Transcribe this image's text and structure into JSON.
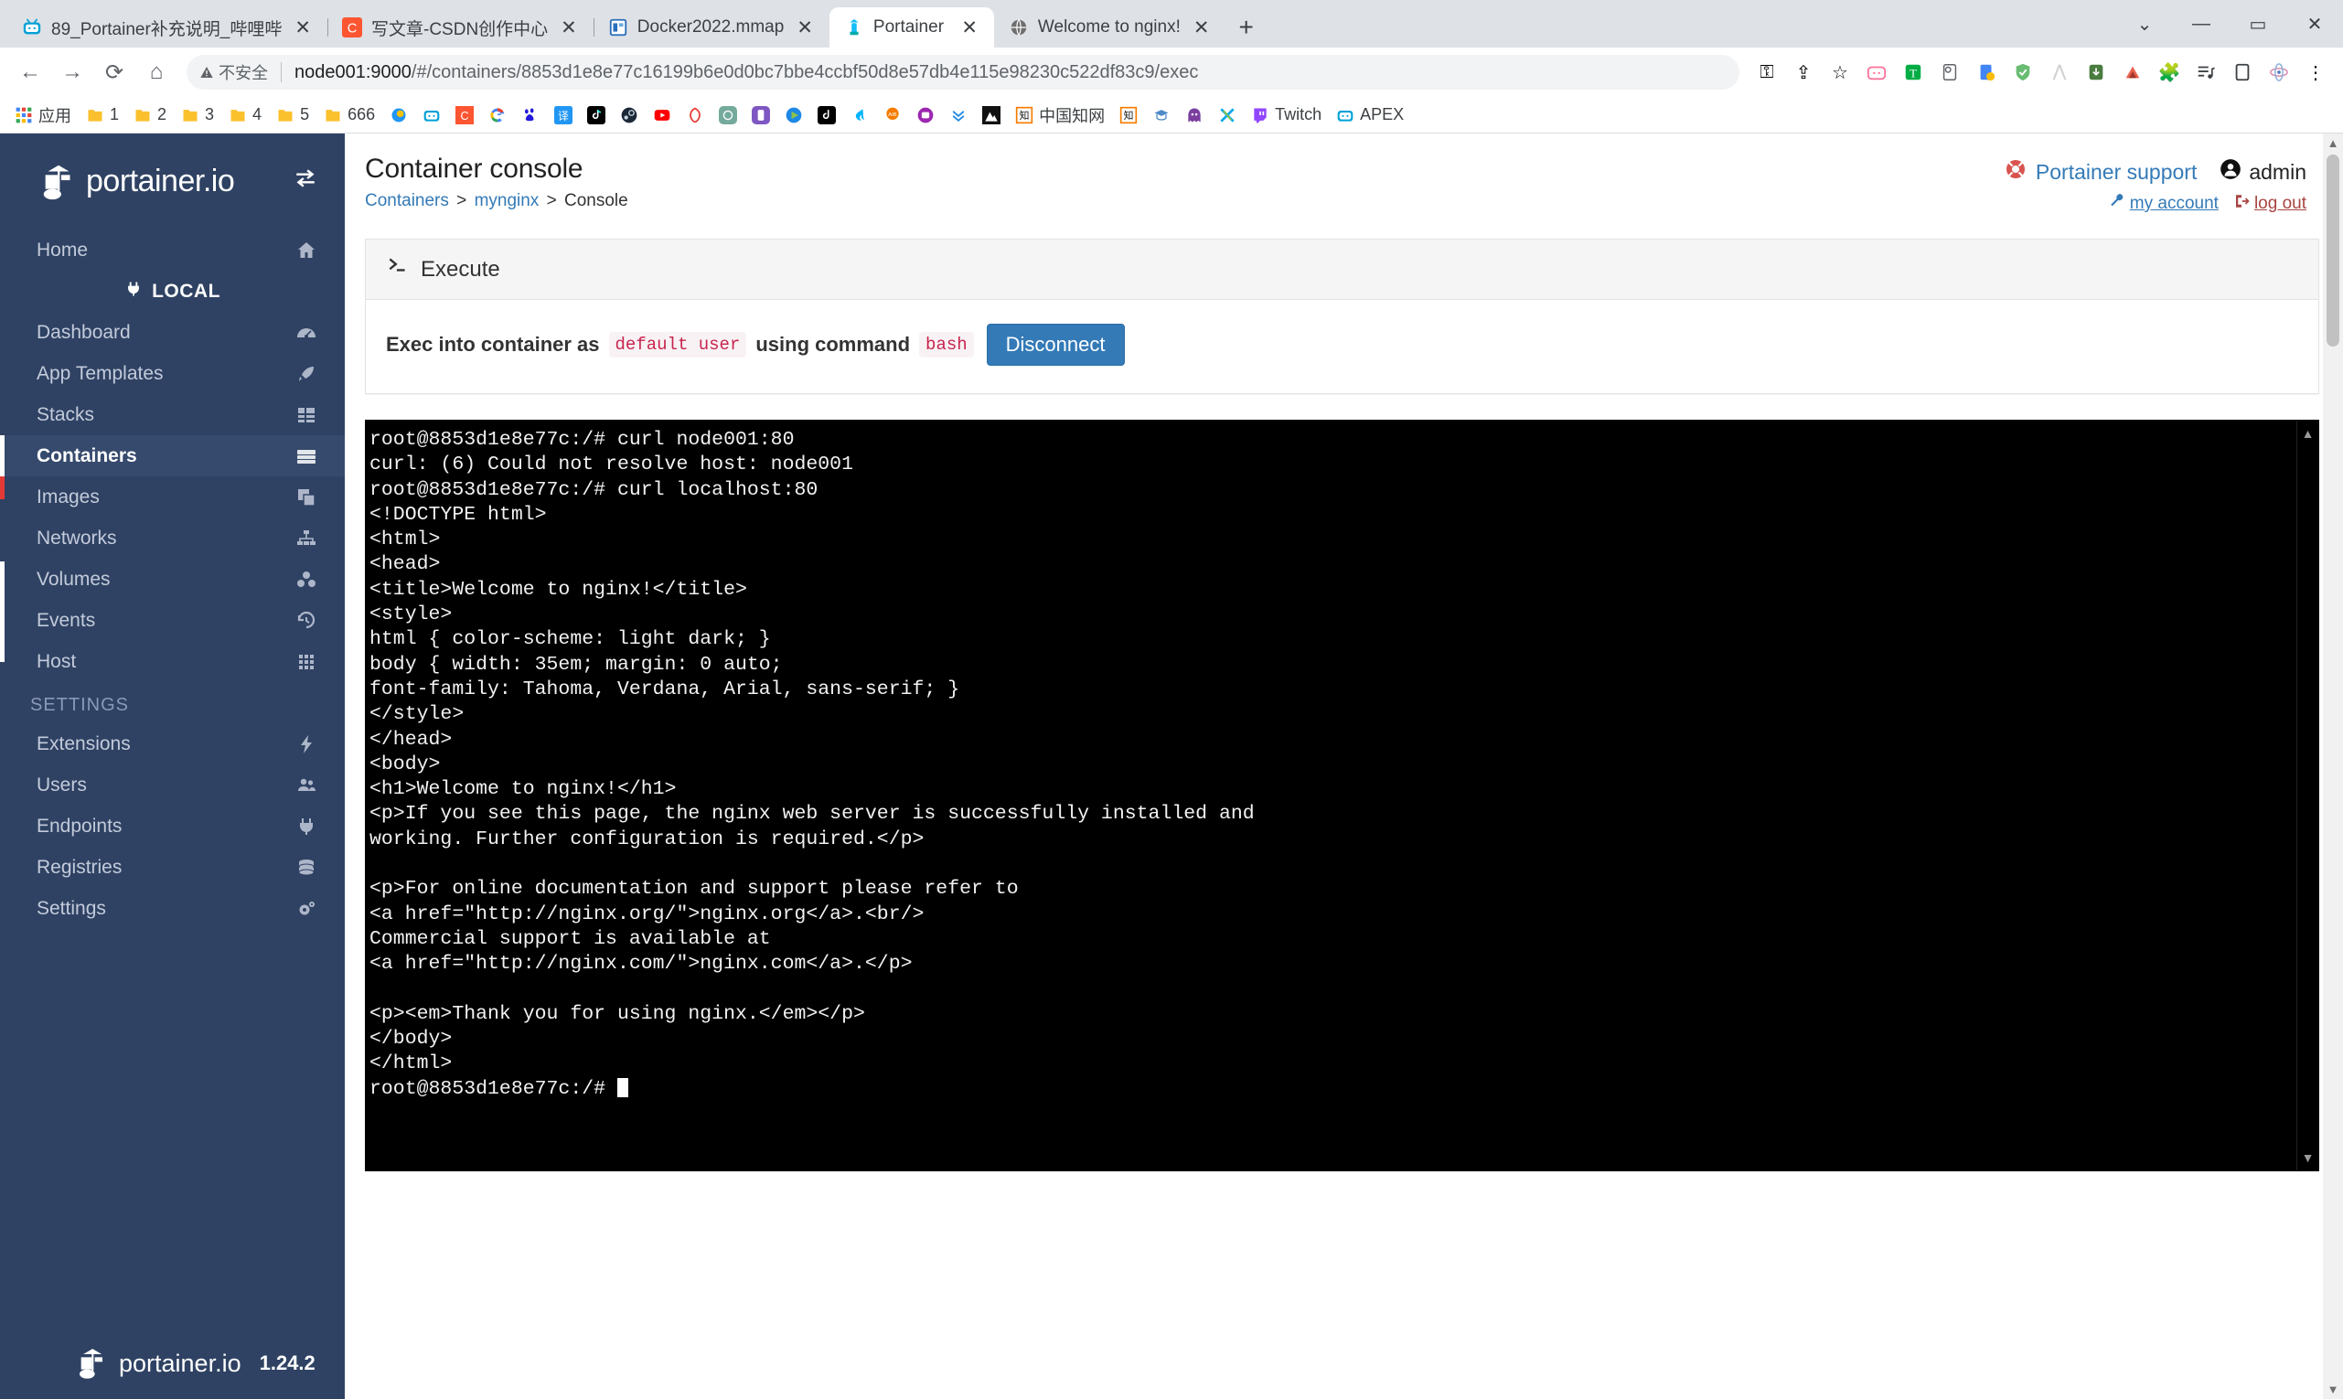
{
  "browser": {
    "tabs": [
      {
        "title": "89_Portainer补充说明_哔哩哔哩",
        "favicon": "bilibili-icon",
        "active": false
      },
      {
        "title": "写文章-CSDN创作中心",
        "favicon": "csdn-icon",
        "active": false
      },
      {
        "title": "Docker2022.mmap",
        "favicon": "mindmap-icon",
        "active": false
      },
      {
        "title": "Portainer",
        "favicon": "portainer-icon",
        "active": true
      },
      {
        "title": "Welcome to nginx!",
        "favicon": "globe-icon",
        "active": false
      }
    ],
    "tab_close_label": "✕",
    "new_tab_label": "+",
    "window_controls": {
      "minimize": "—",
      "maximize": "▭",
      "close": "✕"
    },
    "nav": {
      "back": "←",
      "forward": "→",
      "reload": "⟳",
      "home": "⌂"
    },
    "omnibox": {
      "security_icon": "warning-triangle-icon",
      "security_label": "不安全",
      "url_host": "node001:9000",
      "url_path": "/#/containers/8853d1e8e77c16199b6e0d0bc7bbe4ccbf50d8e57db4e115e98230c522df83c9/exec"
    },
    "toolbar_icons": [
      "key-icon",
      "share-icon",
      "bookmark-star-icon",
      "bilibili-ext-icon",
      "tampermonkey-icon",
      "pocket-icon",
      "downloader-icon",
      "adguard-icon",
      "a-ext-icon",
      "download-ext-icon",
      "sourcetree-icon",
      "puzzle-extensions-icon",
      "playlist-icon",
      "sidepanel-icon",
      "atom-ext-icon",
      "menu-kebab-icon"
    ],
    "bookmarks": [
      {
        "label": "应用",
        "icon": "apps-grid-icon"
      },
      {
        "label": "1",
        "icon": "folder-icon"
      },
      {
        "label": "2",
        "icon": "folder-icon"
      },
      {
        "label": "3",
        "icon": "folder-icon"
      },
      {
        "label": "4",
        "icon": "folder-icon"
      },
      {
        "label": "5",
        "icon": "folder-icon"
      },
      {
        "label": "666",
        "icon": "folder-icon"
      },
      {
        "label": "",
        "icon": "weather-icon"
      },
      {
        "label": "",
        "icon": "bilibili-icon"
      },
      {
        "label": "",
        "icon": "csdn-icon"
      },
      {
        "label": "",
        "icon": "google-icon"
      },
      {
        "label": "",
        "icon": "baidu-icon"
      },
      {
        "label": "",
        "icon": "translate-icon"
      },
      {
        "label": "",
        "icon": "tiktok-icon"
      },
      {
        "label": "",
        "icon": "steam-icon"
      },
      {
        "label": "",
        "icon": "youtube-icon"
      },
      {
        "label": "",
        "icon": "zhihu-icon"
      },
      {
        "label": "",
        "icon": "openai-icon"
      },
      {
        "label": "",
        "icon": "mobile-app-icon"
      },
      {
        "label": "",
        "icon": "potplayer-icon"
      },
      {
        "label": "",
        "icon": "douyin-icon"
      },
      {
        "label": "",
        "icon": "swift-icon"
      },
      {
        "label": "",
        "icon": "aib-icon"
      },
      {
        "label": "",
        "icon": "chat-icon"
      },
      {
        "label": "",
        "icon": "chevrons-down-icon"
      },
      {
        "label": "",
        "icon": "mountain-icon"
      },
      {
        "label": "中国知网",
        "icon": "cnki-icon"
      },
      {
        "label": "",
        "icon": "cnki-box-icon"
      },
      {
        "label": "",
        "icon": "scholar-icon"
      },
      {
        "label": "",
        "icon": "ghost-icon"
      },
      {
        "label": "",
        "icon": "xshell-icon"
      },
      {
        "label": "Twitch",
        "icon": "twitch-icon"
      },
      {
        "label": "APEX",
        "icon": "bilibili-icon"
      }
    ]
  },
  "sidebar": {
    "brand": "portainer.io",
    "toggle_icon": "collapse-arrows-icon",
    "items": [
      {
        "label": "Home",
        "icon": "home-icon",
        "active": false
      },
      {
        "label": "Dashboard",
        "icon": "dashboard-icon",
        "active": false
      },
      {
        "label": "App Templates",
        "icon": "rocket-icon",
        "active": false
      },
      {
        "label": "Stacks",
        "icon": "stacks-icon",
        "active": false
      },
      {
        "label": "Containers",
        "icon": "containers-icon",
        "active": true
      },
      {
        "label": "Images",
        "icon": "images-icon",
        "active": false
      },
      {
        "label": "Networks",
        "icon": "networks-icon",
        "active": false
      },
      {
        "label": "Volumes",
        "icon": "volumes-icon",
        "active": false
      },
      {
        "label": "Events",
        "icon": "events-history-icon",
        "active": false
      },
      {
        "label": "Host",
        "icon": "host-grid-icon",
        "active": false
      }
    ],
    "local_label": "LOCAL",
    "local_icon": "plug-icon",
    "settings_heading": "SETTINGS",
    "settings_items": [
      {
        "label": "Extensions",
        "icon": "bolt-icon"
      },
      {
        "label": "Users",
        "icon": "users-icon"
      },
      {
        "label": "Endpoints",
        "icon": "plug-icon"
      },
      {
        "label": "Registries",
        "icon": "database-icon"
      },
      {
        "label": "Settings",
        "icon": "gears-icon"
      }
    ],
    "footer_brand": "portainer.io",
    "footer_version": "1.24.2"
  },
  "header": {
    "title": "Container console",
    "breadcrumb": {
      "root": "Containers",
      "container": "mynginx",
      "current": "Console",
      "separator": ">"
    },
    "support_label": "Portainer support",
    "support_icon": "lifebuoy-icon",
    "user_name": "admin",
    "user_icon": "user-circle-icon",
    "my_account_label": "my account",
    "my_account_icon": "wrench-icon",
    "logout_label": "log out",
    "logout_icon": "logout-icon"
  },
  "execute_panel": {
    "header_title": "Execute",
    "header_icon": "terminal-prompt-icon",
    "exec_text_1": "Exec into container as",
    "exec_user": "default user",
    "exec_text_2": "using command",
    "exec_command": "bash",
    "disconnect_label": "Disconnect"
  },
  "terminal": {
    "lines": [
      "root@8853d1e8e77c:/# curl node001:80",
      "curl: (6) Could not resolve host: node001",
      "root@8853d1e8e77c:/# curl localhost:80",
      "<!DOCTYPE html>",
      "<html>",
      "<head>",
      "<title>Welcome to nginx!</title>",
      "<style>",
      "html { color-scheme: light dark; }",
      "body { width: 35em; margin: 0 auto;",
      "font-family: Tahoma, Verdana, Arial, sans-serif; }",
      "</style>",
      "</head>",
      "<body>",
      "<h1>Welcome to nginx!</h1>",
      "<p>If you see this page, the nginx web server is successfully installed and",
      "working. Further configuration is required.</p>",
      "",
      "<p>For online documentation and support please refer to",
      "<a href=\"http://nginx.org/\">nginx.org</a>.<br/>",
      "Commercial support is available at",
      "<a href=\"http://nginx.com/\">nginx.com</a>.</p>",
      "",
      "<p><em>Thank you for using nginx.</em></p>",
      "</body>",
      "</html>"
    ],
    "prompt": "root@8853d1e8e77c:/# ",
    "scroll_up": "▲",
    "scroll_down": "▼"
  }
}
